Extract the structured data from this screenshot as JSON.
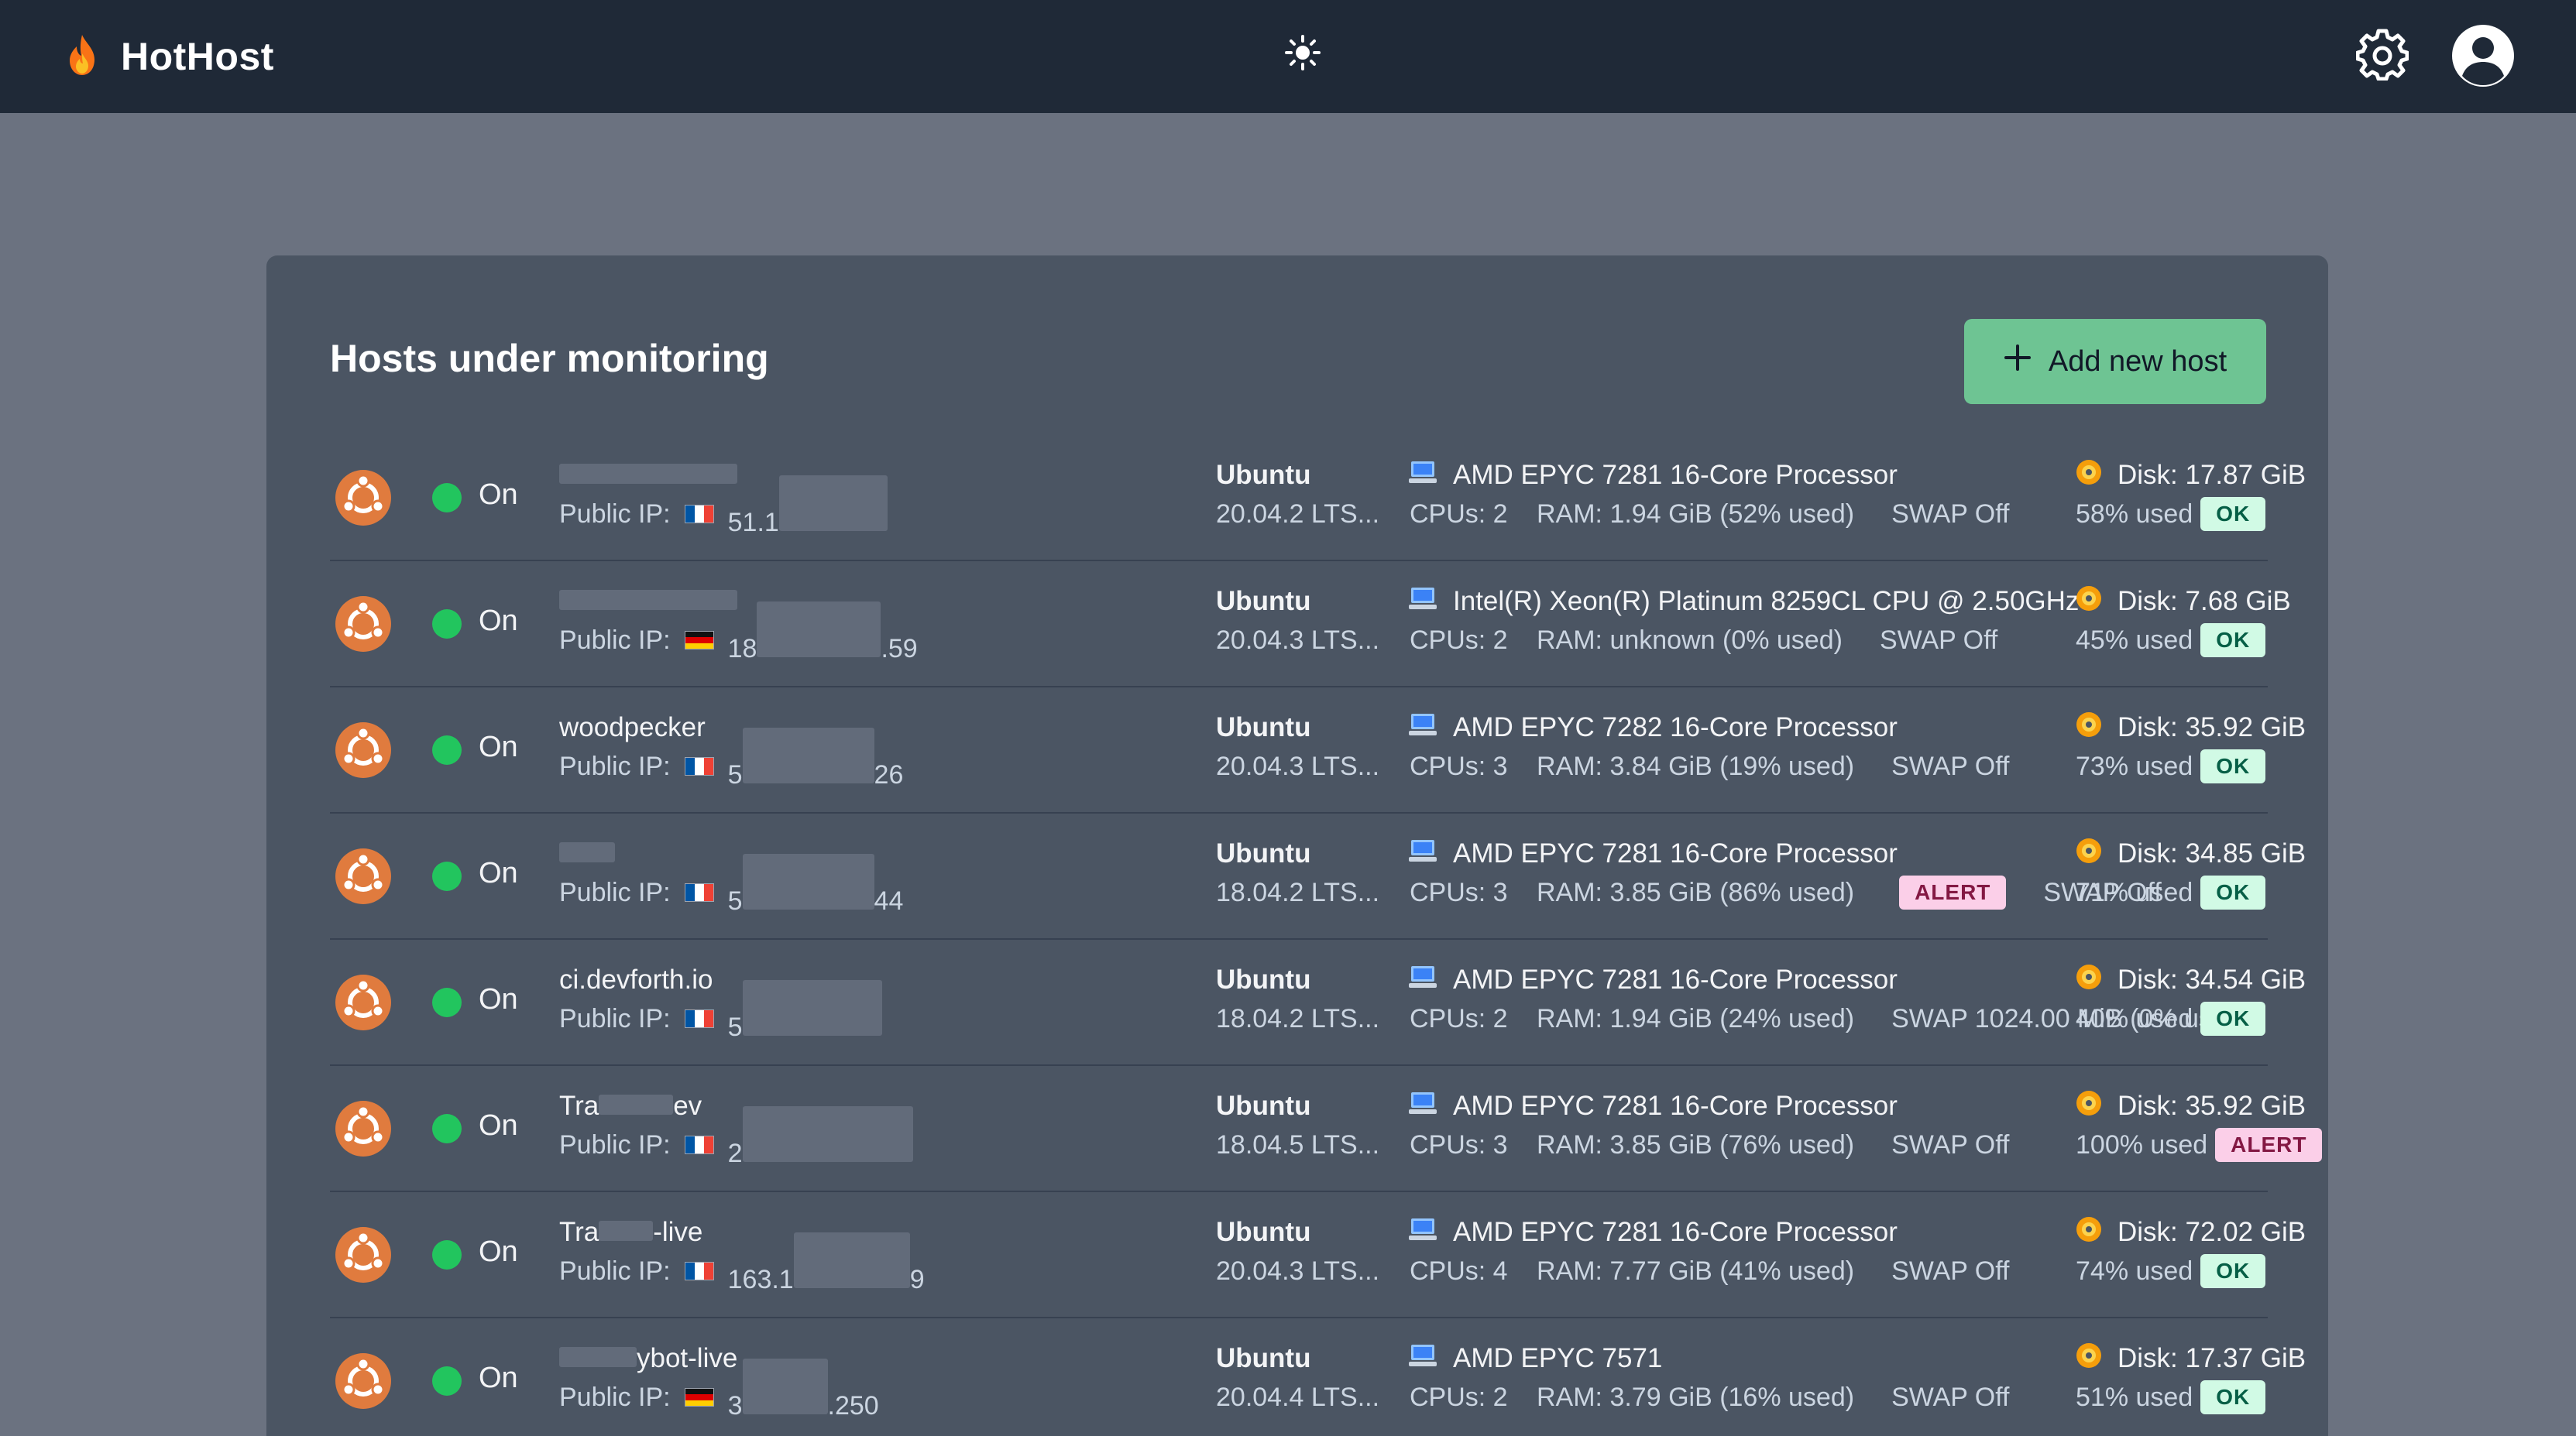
{
  "app": {
    "name": "HotHost"
  },
  "header": {
    "theme_icon": "sun-icon",
    "settings_icon": "gear-icon",
    "avatar_icon": "user-circle-icon"
  },
  "panel": {
    "title": "Hosts under monitoring",
    "add_button_label": "Add new host"
  },
  "labels": {
    "public_ip": "Public IP:",
    "swap_off": "SWAP Off"
  },
  "colors": {
    "accent": "#6ec493",
    "status_on": "#22c55e",
    "ubuntu": "#e95420",
    "ok_bg": "#d1fae5",
    "alert_bg": "#fbcfe8"
  },
  "hosts": [
    {
      "name_prefix": "",
      "name_suffix": "",
      "status": "On",
      "flag": "fr",
      "ip_prefix": "51.1",
      "ip_suffix": "",
      "os": "Ubuntu",
      "os_version": "20.04.2 LTS...",
      "cpu_model": "AMD EPYC 7281 16-Core Processor",
      "cpus": "CPUs: 2",
      "ram": "RAM: 1.94 GiB (52% used)",
      "ram_badge": "",
      "swap": "SWAP Off",
      "disk": "Disk: 17.87 GiB",
      "disk_used": "58% used",
      "disk_badge": "OK"
    },
    {
      "name_prefix": "",
      "name_suffix": "",
      "status": "On",
      "flag": "de",
      "ip_prefix": "18",
      "ip_suffix": ".59",
      "os": "Ubuntu",
      "os_version": "20.04.3 LTS...",
      "cpu_model": "Intel(R) Xeon(R) Platinum 8259CL CPU @ 2.50GHz",
      "cpus": "CPUs: 2",
      "ram": "RAM: unknown (0% used)",
      "ram_badge": "",
      "swap": "SWAP Off",
      "disk": "Disk: 7.68 GiB",
      "disk_used": "45% used",
      "disk_badge": "OK"
    },
    {
      "name_prefix": "woodpecker",
      "name_suffix": "",
      "status": "On",
      "flag": "fr",
      "ip_prefix": "5",
      "ip_suffix": "26",
      "os": "Ubuntu",
      "os_version": "20.04.3 LTS...",
      "cpu_model": "AMD EPYC 7282 16-Core Processor",
      "cpus": "CPUs: 3",
      "ram": "RAM: 3.84 GiB (19% used)",
      "ram_badge": "",
      "swap": "SWAP Off",
      "disk": "Disk: 35.92 GiB",
      "disk_used": "73% used",
      "disk_badge": "OK"
    },
    {
      "name_prefix": "",
      "name_suffix": "",
      "status": "On",
      "flag": "fr",
      "ip_prefix": "5",
      "ip_suffix": "44",
      "os": "Ubuntu",
      "os_version": "18.04.2 LTS...",
      "cpu_model": "AMD EPYC 7281 16-Core Processor",
      "cpus": "CPUs: 3",
      "ram": "RAM: 3.85 GiB (86% used)",
      "ram_badge": "ALERT",
      "swap": "SWAP Off",
      "disk": "Disk: 34.85 GiB",
      "disk_used": "71% used",
      "disk_badge": "OK"
    },
    {
      "name_prefix": "ci.devforth.io",
      "name_suffix": "",
      "status": "On",
      "flag": "fr",
      "ip_prefix": "5",
      "ip_suffix": "",
      "os": "Ubuntu",
      "os_version": "18.04.2 LTS...",
      "cpu_model": "AMD EPYC 7281 16-Core Processor",
      "cpus": "CPUs: 2",
      "ram": "RAM: 1.94 GiB (24% used)",
      "ram_badge": "",
      "swap": "SWAP 1024.00 MiB (0% used)",
      "disk": "Disk: 34.54 GiB",
      "disk_used": "40% used",
      "disk_badge": "OK"
    },
    {
      "name_prefix": "Tra",
      "name_suffix": "ev",
      "status": "On",
      "flag": "fr",
      "ip_prefix": "2",
      "ip_suffix": "",
      "os": "Ubuntu",
      "os_version": "18.04.5 LTS...",
      "cpu_model": "AMD EPYC 7281 16-Core Processor",
      "cpus": "CPUs: 3",
      "ram": "RAM: 3.85 GiB (76% used)",
      "ram_badge": "",
      "swap": "SWAP Off",
      "disk": "Disk: 35.92 GiB",
      "disk_used": "100% used",
      "disk_badge": "ALERT"
    },
    {
      "name_prefix": "Tra",
      "name_suffix": "-live",
      "status": "On",
      "flag": "fr",
      "ip_prefix": "163.1",
      "ip_suffix": "9",
      "os": "Ubuntu",
      "os_version": "20.04.3 LTS...",
      "cpu_model": "AMD EPYC 7281 16-Core Processor",
      "cpus": "CPUs: 4",
      "ram": "RAM: 7.77 GiB (41% used)",
      "ram_badge": "",
      "swap": "SWAP Off",
      "disk": "Disk: 72.02 GiB",
      "disk_used": "74% used",
      "disk_badge": "OK"
    },
    {
      "name_prefix": "",
      "name_suffix": "ybot-live",
      "status": "On",
      "flag": "de",
      "ip_prefix": "3",
      "ip_suffix": ".250",
      "os": "Ubuntu",
      "os_version": "20.04.4 LTS...",
      "cpu_model": "AMD EPYC 7571",
      "cpus": "CPUs: 2",
      "ram": "RAM: 3.79 GiB (16% used)",
      "ram_badge": "",
      "swap": "SWAP Off",
      "disk": "Disk: 17.37 GiB",
      "disk_used": "51% used",
      "disk_badge": "OK"
    }
  ]
}
